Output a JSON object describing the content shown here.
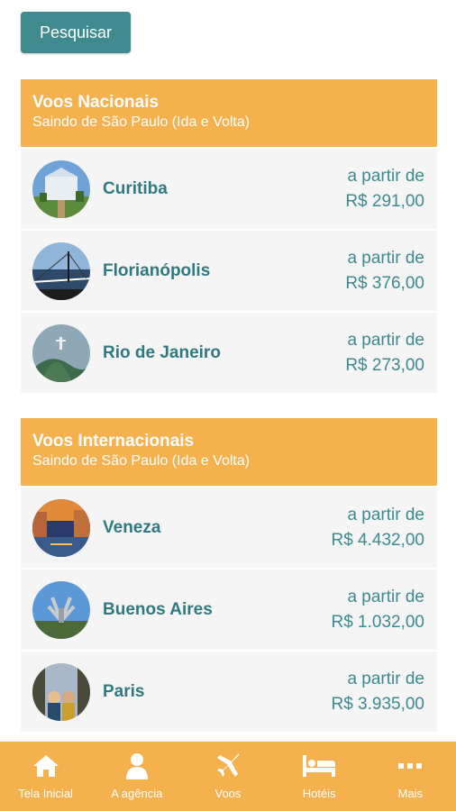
{
  "search_button": "Pesquisar",
  "national": {
    "title": "Voos Nacionais",
    "subtitle": "Saindo de São Paulo (Ida e Volta)",
    "items": [
      {
        "name": "Curitiba",
        "prefix": "a partir de",
        "price": "R$ 291,00"
      },
      {
        "name": "Florianópolis",
        "prefix": "a partir de",
        "price": "R$ 376,00"
      },
      {
        "name": "Rio de Janeiro",
        "prefix": "a partir de",
        "price": "R$ 273,00"
      }
    ]
  },
  "international": {
    "title": "Voos Internacionais",
    "subtitle": "Saindo de São Paulo (Ida e Volta)",
    "items": [
      {
        "name": "Veneza",
        "prefix": "a partir de",
        "price": "R$ 4.432,00"
      },
      {
        "name": "Buenos Aires",
        "prefix": "a partir de",
        "price": "R$ 1.032,00"
      },
      {
        "name": "Paris",
        "prefix": "a partir de",
        "price": "R$ 3.935,00"
      }
    ]
  },
  "nav": [
    {
      "label": "Tela Inicial",
      "icon": "home-icon"
    },
    {
      "label": "A agência",
      "icon": "user-icon"
    },
    {
      "label": "Voos",
      "icon": "airplane-icon"
    },
    {
      "label": "Hotéis",
      "icon": "bed-icon"
    },
    {
      "label": "Mais",
      "icon": "more-icon"
    }
  ],
  "colors": {
    "accent_orange": "#f6b14f",
    "teal": "#3e8a8f",
    "row_bg": "#f5f5f5"
  }
}
